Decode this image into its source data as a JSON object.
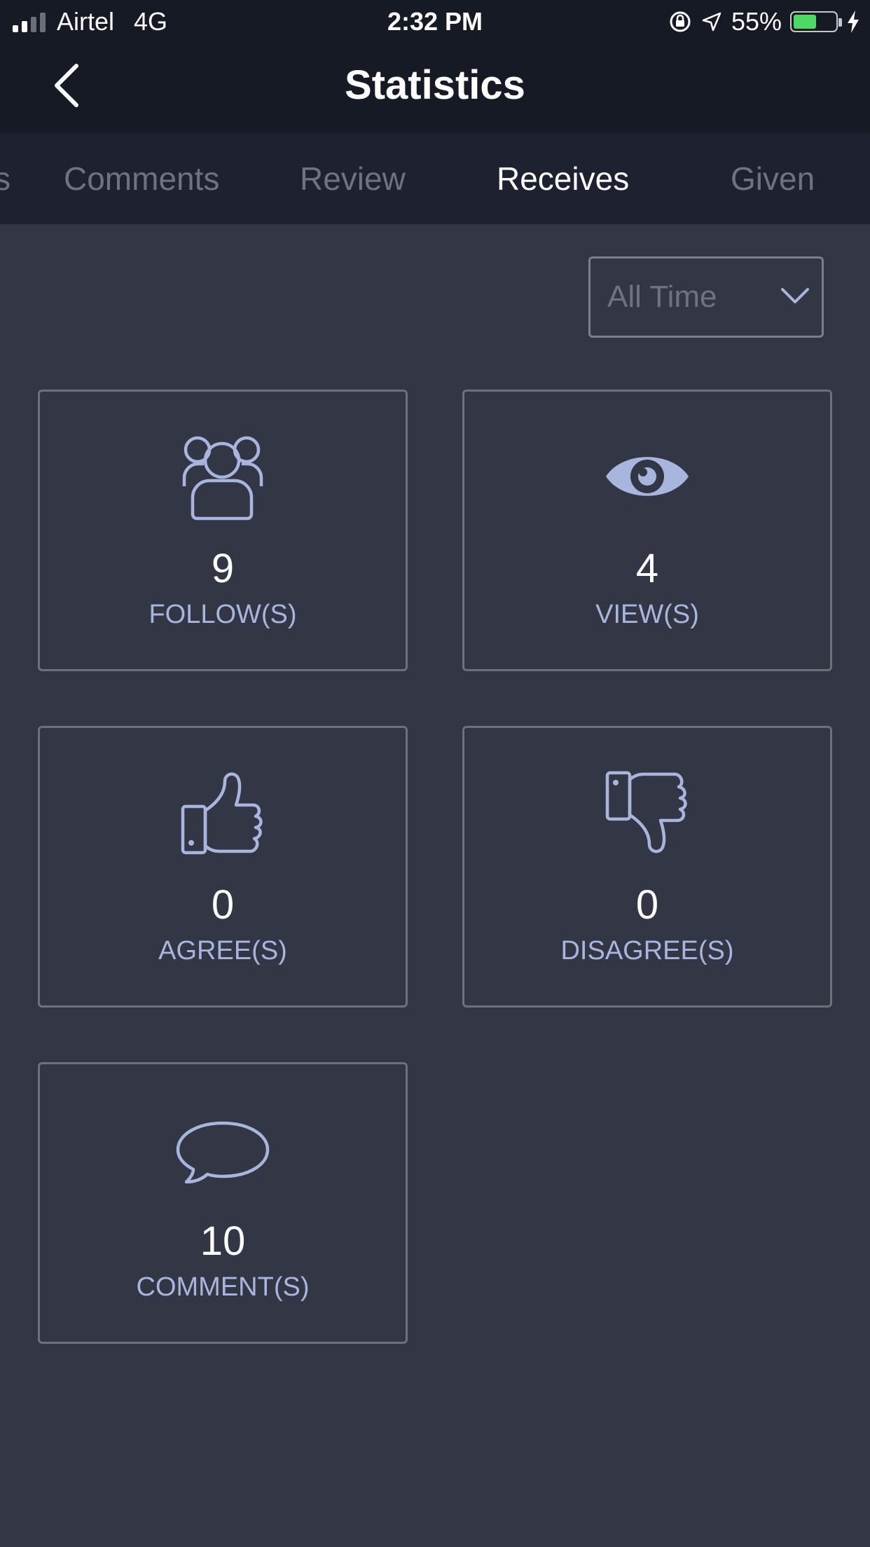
{
  "status_bar": {
    "carrier": "Airtel",
    "network": "4G",
    "time": "2:32 PM",
    "battery": "55%",
    "battery_level": 0.55,
    "battery_color": "#4cd964"
  },
  "header": {
    "title": "Statistics",
    "back_icon": "chevron-left-icon"
  },
  "tabs": [
    {
      "label": "s",
      "active": false
    },
    {
      "label": "Comments",
      "active": false
    },
    {
      "label": "Review",
      "active": false
    },
    {
      "label": "Receives",
      "active": true
    },
    {
      "label": "Given",
      "active": false
    }
  ],
  "filter": {
    "selected": "All Time",
    "icon": "chevron-down-icon"
  },
  "stats": [
    {
      "value": "9",
      "label": "FOLLOW(S)",
      "icon": "followers-icon"
    },
    {
      "value": "4",
      "label": "VIEW(S)",
      "icon": "eye-icon"
    },
    {
      "value": "0",
      "label": "AGREE(S)",
      "icon": "thumbs-up-icon"
    },
    {
      "value": "0",
      "label": "DISAGREE(S)",
      "icon": "thumbs-down-icon"
    },
    {
      "value": "10",
      "label": "COMMENT(S)",
      "icon": "comment-icon"
    }
  ],
  "colors": {
    "background": "#323645",
    "header": "#161a24",
    "tabbar": "#1e2230",
    "accent": "#a8b6de",
    "text_active": "#ffffff",
    "text_inactive": "#6e7281"
  }
}
